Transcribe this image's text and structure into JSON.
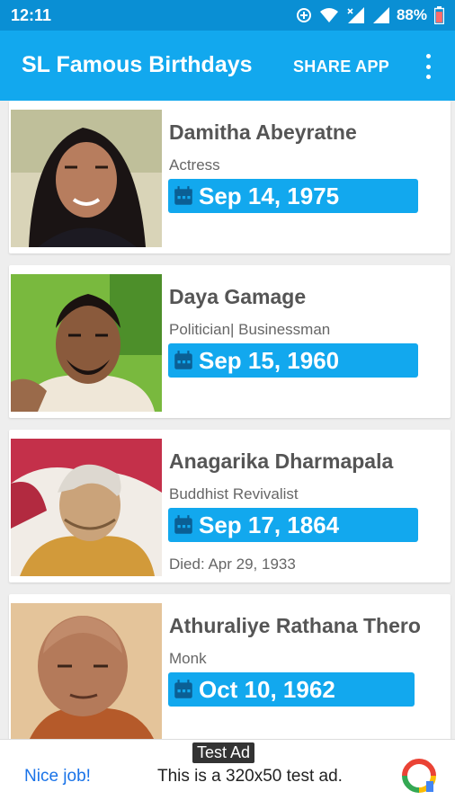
{
  "status_bar": {
    "time": "12:11",
    "battery": "88%",
    "icons": [
      "data-saver-icon",
      "wifi-icon",
      "signal-x-icon",
      "signal-icon",
      "battery-icon"
    ]
  },
  "app_bar": {
    "title": "SL Famous Birthdays",
    "share_label": "SHARE APP",
    "overflow_icon": "more-vert-icon"
  },
  "people": [
    {
      "name": "Damitha Abeyratne",
      "occupation": "Actress",
      "birthday": "Sep 14, 1975",
      "died": ""
    },
    {
      "name": "Daya Gamage",
      "occupation": "Politician| Businessman",
      "birthday": "Sep 15, 1960",
      "died": ""
    },
    {
      "name": "Anagarika Dharmapala",
      "occupation": "Buddhist Revivalist",
      "birthday": "Sep 17, 1864",
      "died": "Died: Apr 29, 1933"
    },
    {
      "name": "Athuraliye Rathana Thero",
      "occupation": "Monk",
      "birthday": "Oct 10, 1962",
      "died": ""
    }
  ],
  "ad": {
    "badge": "Test Ad",
    "cta": "Nice job!",
    "text": "This is a 320x50 test ad.",
    "logo_icon": "ad-logo-icon"
  },
  "colors": {
    "status_bar": "#0a8fd4",
    "app_bar": "#12a8ee",
    "date_pill": "#12a8ee",
    "name_text": "#555555",
    "ad_link": "#1a73e8"
  }
}
